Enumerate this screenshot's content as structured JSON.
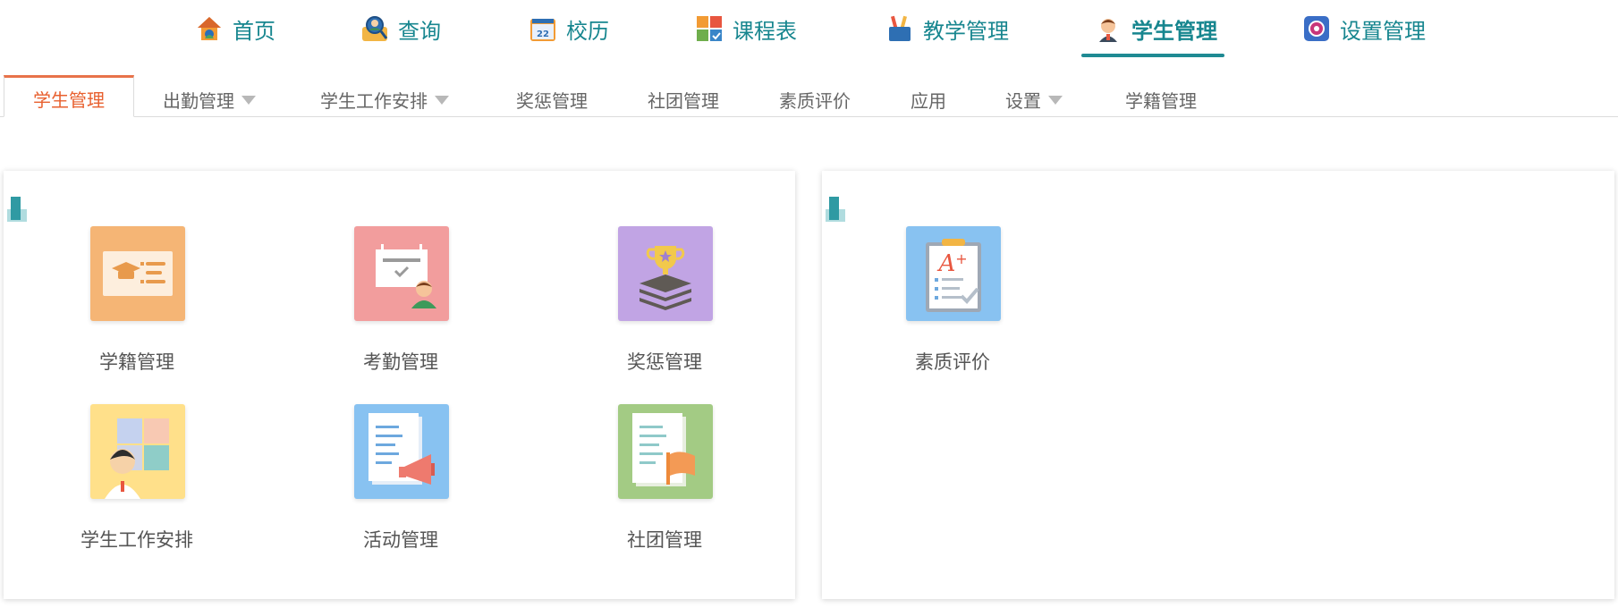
{
  "top_nav": {
    "items": [
      {
        "label": "首页",
        "icon": "home-icon"
      },
      {
        "label": "查询",
        "icon": "search-person-icon"
      },
      {
        "label": "校历",
        "icon": "calendar-icon"
      },
      {
        "label": "课程表",
        "icon": "timetable-icon"
      },
      {
        "label": "教学管理",
        "icon": "pencil-cup-icon"
      },
      {
        "label": "学生管理",
        "icon": "student-avatar-icon",
        "active": true
      },
      {
        "label": "设置管理",
        "icon": "settings-gear-icon"
      }
    ]
  },
  "sub_nav": {
    "items": [
      {
        "label": "学生管理",
        "active": true
      },
      {
        "label": "出勤管理",
        "dropdown": true
      },
      {
        "label": "学生工作安排",
        "dropdown": true
      },
      {
        "label": "奖惩管理"
      },
      {
        "label": "社团管理"
      },
      {
        "label": "素质评价"
      },
      {
        "label": "应用"
      },
      {
        "label": "设置",
        "dropdown": true
      },
      {
        "label": "学籍管理"
      }
    ]
  },
  "panels": {
    "left": {
      "tiles": [
        {
          "label": "学籍管理",
          "icon": "graduation-card-icon",
          "color": "#f5b575"
        },
        {
          "label": "考勤管理",
          "icon": "attendance-board-icon",
          "color": "#f29d9d"
        },
        {
          "label": "奖惩管理",
          "icon": "trophy-icon",
          "color": "#c1a4e4"
        },
        {
          "label": "学生工作安排",
          "icon": "student-schedule-icon",
          "color": "#ffe08a"
        },
        {
          "label": "活动管理",
          "icon": "megaphone-document-icon",
          "color": "#88c2f1"
        },
        {
          "label": "社团管理",
          "icon": "club-flag-icon",
          "color": "#a3cb84"
        }
      ]
    },
    "right": {
      "tiles": [
        {
          "label": "素质评价",
          "icon": "grade-a-plus-icon",
          "color": "#88c2f1"
        }
      ]
    }
  },
  "colors": {
    "accent_teal": "#17868f",
    "active_orange": "#e8602f"
  }
}
